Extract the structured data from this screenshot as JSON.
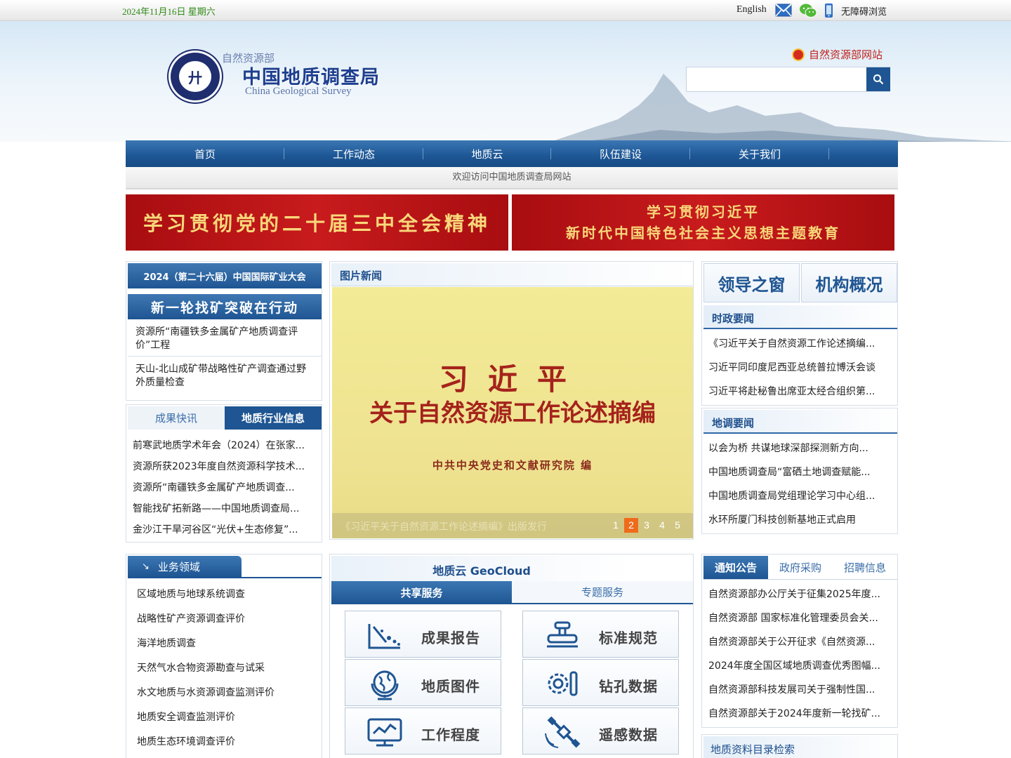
{
  "topbar": {
    "date": "2024年11月16日 星期六",
    "english": "English",
    "accessible": "无障碍浏览"
  },
  "header": {
    "ministry": "自然资源部",
    "title": "中国地质调查局",
    "title_en": "China Geological Survey",
    "mnr_link": "自然资源部网站",
    "search_placeholder": ""
  },
  "nav": [
    "首页",
    "工作动态",
    "地质云",
    "队伍建设",
    "关于我们"
  ],
  "welcome": "欢迎访问中国地质调查局网站",
  "banners": {
    "left": "学习贯彻党的二十届三中全会精神",
    "right_line1": "学习贯彻习近平",
    "right_line2": "新时代中国特色社会主义思想主题教育"
  },
  "left": {
    "conf_banner": "2024（第二十六届）中国国际矿业大会",
    "prospect_banner": "新一轮找矿突破在行动",
    "prospect_news": [
      "资源所“南疆铁多金属矿产地质调查评价”工程",
      "天山-北山成矿带战略性矿产调查通过野外质量检查"
    ],
    "tabs": [
      "成果快讯",
      "地质行业信息"
    ],
    "tab_news": [
      "前寒武地质学术年会（2024）在张家...",
      "资源所获2023年度自然资源科学技术...",
      "资源所“南疆铁多金属矿产地质调查...",
      "智能找矿拓新路——中国地质调查局...",
      "金沙江干旱河谷区“光伏+生态修复”..."
    ],
    "biz_title": "业务领域",
    "biz_items": [
      "区域地质与地球系统调查",
      "战略性矿产资源调查评价",
      "海洋地质调查",
      "天然气水合物资源勘查与试采",
      "水文地质与水资源调查监测评价",
      "地质安全调查监测评价",
      "地质生态环境调查评价"
    ]
  },
  "middle": {
    "photo_title": "图片新闻",
    "photo_text1": "习近平",
    "photo_text2": "关于自然资源工作论述摘编",
    "photo_text3": "中共中央党史和文献研究院 编",
    "photo_caption": "《习近平关于自然资源工作论述摘编》出版发行",
    "pages": [
      "1",
      "2",
      "3",
      "4",
      "5"
    ],
    "active_page": "2",
    "geo_title": "地质云 GeoCloud",
    "svc_tabs": [
      "共享服务",
      "专题服务"
    ],
    "services": [
      "成果报告",
      "标准规范",
      "地质图件",
      "钻孔数据",
      "工作程度",
      "遥感数据"
    ]
  },
  "right": {
    "top_buttons": [
      "领导之窗",
      "机构概况"
    ],
    "politics_title": "时政要闻",
    "politics": [
      "《习近平关于自然资源工作论述摘编...",
      "习近平同印度尼西亚总统普拉博沃会谈",
      "习近平将赴秘鲁出席亚太经合组织第..."
    ],
    "survey_title": "地调要闻",
    "survey": [
      "以会为桥 共谋地球深部探测新方向...",
      "中国地质调查局“富硒土地调查赋能...",
      "中国地质调查局党组理论学习中心组...",
      "水环所厦门科技创新基地正式启用"
    ],
    "notice_tabs": [
      "通知公告",
      "政府采购",
      "招聘信息"
    ],
    "notices": [
      "自然资源部办公厅关于征集2025年度...",
      "自然资源部 国家标准化管理委员会关...",
      "自然资源部关于公开征求《自然资源...",
      "2024年度全国区域地质调查优秀图幅...",
      "自然资源部科技发展司关于强制性国...",
      "自然资源部关于2024年度新一轮找矿..."
    ],
    "catalog_title": "地质资料目录检索"
  },
  "colors": {
    "nav_blue": "#1e5592",
    "banner_red": "#b4141a",
    "date_green": "#2f8a17",
    "page_active": "#ef6b1c"
  }
}
